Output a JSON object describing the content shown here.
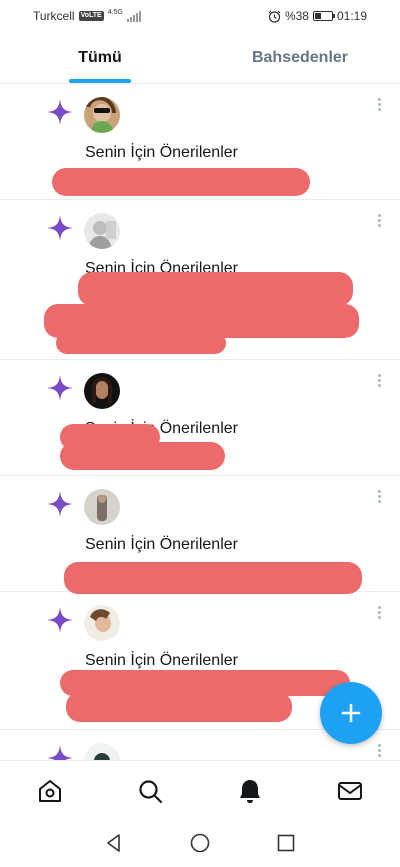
{
  "status_bar": {
    "carrier": "Turkcell",
    "volte": "VoLTE",
    "network": "4.5G",
    "battery_percent": "%38",
    "battery_level": 0.38,
    "time": "01:19"
  },
  "tabs": [
    {
      "label": "Tümü",
      "active": true
    },
    {
      "label": "Bahsedenler",
      "active": false
    }
  ],
  "notifications": [
    {
      "icon": "sparkle-icon",
      "title": "Senin İçin Önerilenler",
      "body_redacted": true
    },
    {
      "icon": "sparkle-icon",
      "title": "Senin İçin Önerilenler",
      "body_redacted": true
    },
    {
      "icon": "sparkle-icon",
      "title": "Senin İçin Önerilenler",
      "body_redacted": true
    },
    {
      "icon": "sparkle-icon",
      "title": "Senin İçin Önerilenler",
      "body_redacted": true
    },
    {
      "icon": "sparkle-icon",
      "title": "Senin İçin Önerilenler",
      "body_redacted": true
    },
    {
      "icon": "sparkle-icon",
      "title": "",
      "body_redacted": false
    }
  ],
  "fab": {
    "icon": "plus-icon"
  },
  "bottom_nav": [
    "home-icon",
    "search-icon",
    "bell-icon",
    "mail-icon"
  ],
  "system_nav": [
    "back-icon",
    "home-circle-icon",
    "recents-icon"
  ],
  "colors": {
    "accent": "#1da1f2",
    "sparkle": "#794bc4",
    "redaction": "#ec6a6a"
  }
}
